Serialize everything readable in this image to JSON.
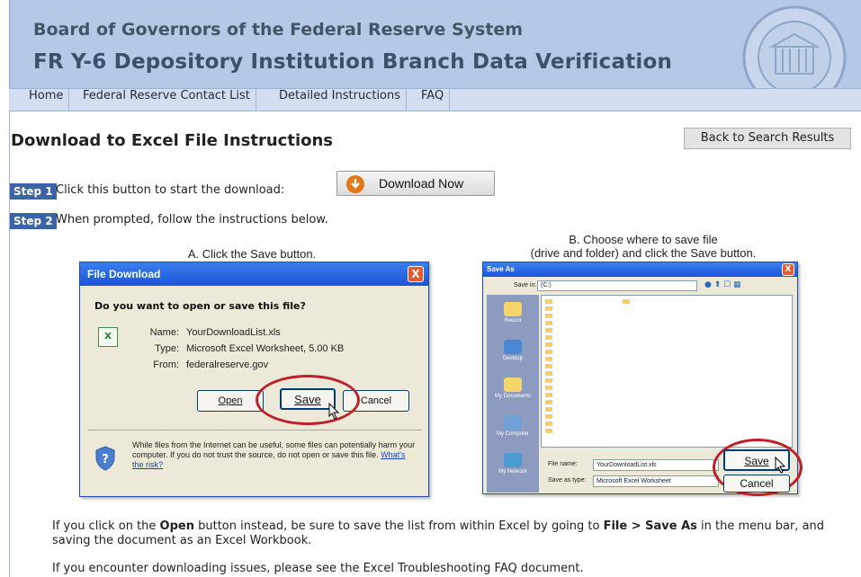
{
  "header": {
    "line1": "Board of Governors of the Federal Reserve System",
    "line2": "FR Y-6 Depository Institution Branch Data Verification",
    "seal_text": "UNITED STATES FEDERAL RESERVE SYSTEM"
  },
  "nav": {
    "items": [
      "Home",
      "Federal Reserve Contact List",
      "Detailed Instructions",
      "FAQ"
    ]
  },
  "page": {
    "title": "Download to Excel File Instructions",
    "back_button": "Back to Search Results"
  },
  "step1": {
    "badge": "Step 1",
    "text": "Click this button to start the download:",
    "button": "Download Now"
  },
  "step2": {
    "badge": "Step 2",
    "text": "When prompted, follow the instructions below.",
    "caption_a": "A. Click the Save button.",
    "caption_b_line1": "B. Choose where to save file",
    "caption_b_line2": "(drive and folder) and click the Save button."
  },
  "dialog_a": {
    "title": "File Download",
    "close": "X",
    "question": "Do you want to open or save this file?",
    "name_label": "Name:",
    "name_value": "YourDownloadList.xls",
    "type_label": "Type:",
    "type_value": "Microsoft Excel Worksheet, 5.00 KB",
    "from_label": "From:",
    "from_value": "federalreserve.gov",
    "open_button": "Open",
    "save_button": "Save",
    "cancel_button": "Cancel",
    "warning": "While files from the Internet can be useful, some files can potentially harm your computer. If you do not trust the source, do not open or save this file.",
    "risk_link": "What's the risk?"
  },
  "dialog_b": {
    "title": "Save As",
    "save_in_label": "Save in:",
    "save_in_value": "(C:)",
    "places": [
      "Recent",
      "Desktop",
      "My Documents",
      "My Computer",
      "My Network"
    ],
    "file_name_label": "File name:",
    "file_name_value": "YourDownloadList.xls",
    "save_as_type_label": "Save as type:",
    "save_as_type_value": "Microsoft Excel Worksheet",
    "save_button": "Save",
    "cancel_button": "Cancel"
  },
  "notes": {
    "open_pre": "If you click on the ",
    "open_bold": "Open",
    "open_mid": " button instead, be sure to save the list from within Excel by going to ",
    "open_menu": "File > Save As",
    "open_post": " in the menu bar, and saving the document as an Excel Workbook.",
    "trouble": "If you encounter downloading issues, please see the Excel Troubleshooting FAQ document."
  }
}
